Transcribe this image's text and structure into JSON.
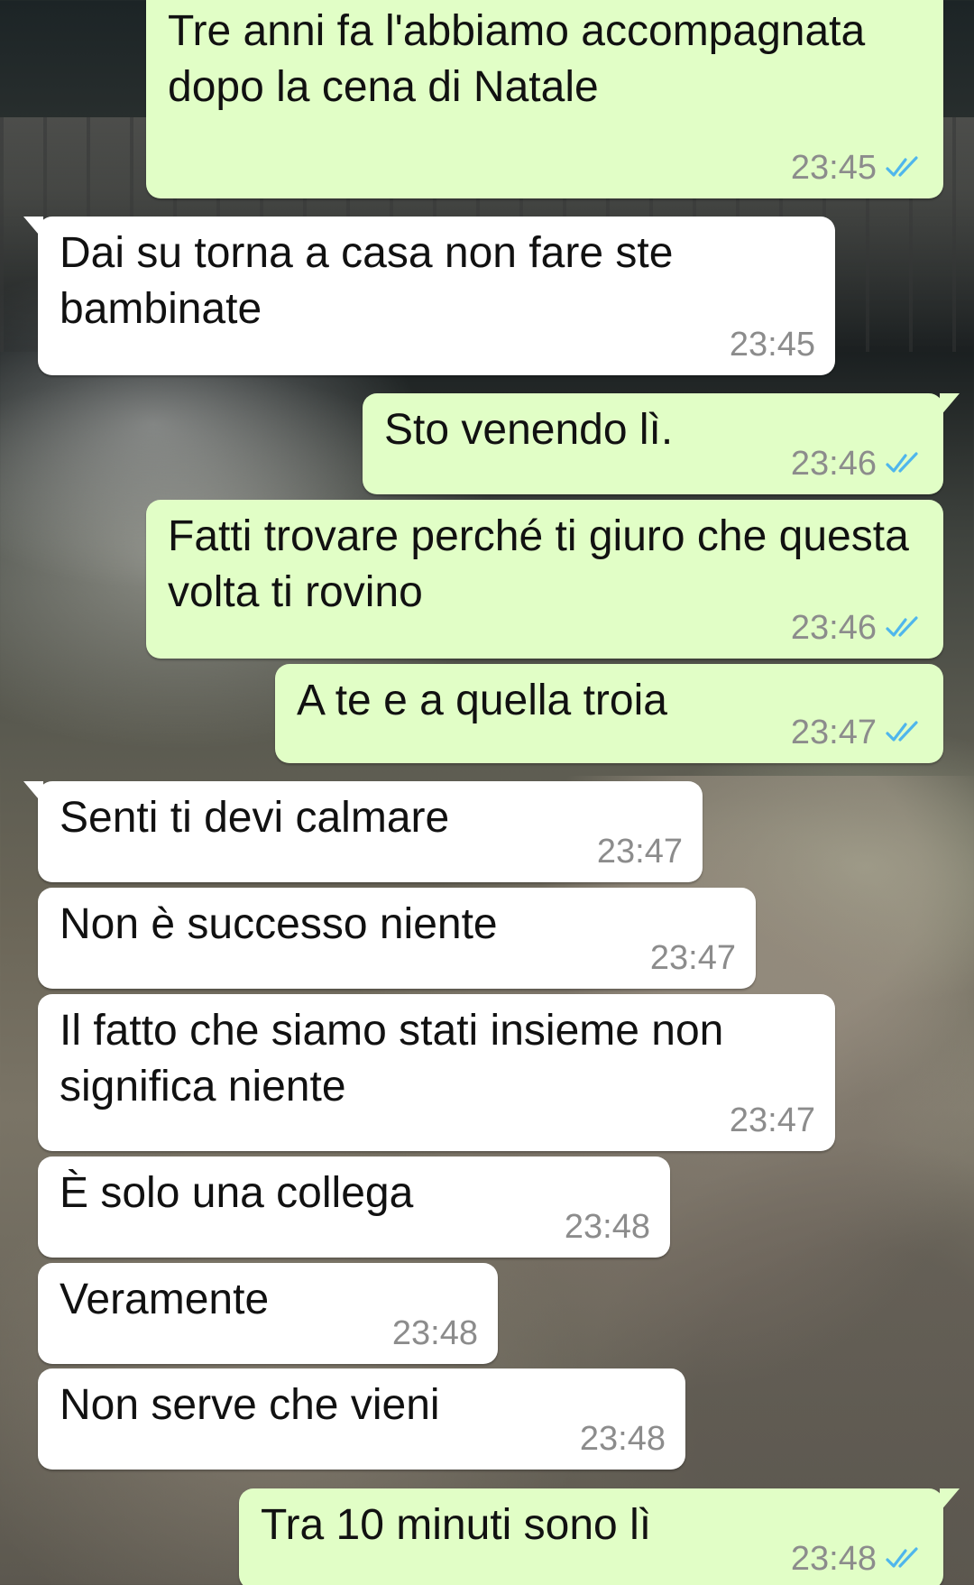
{
  "messages": [
    {
      "dir": "out",
      "text": "Tre anni fa l'abbiamo accompagnata dopo la cena di Natale",
      "time": "23:45",
      "status_icon": "double-check-icon"
    },
    {
      "dir": "in",
      "text": "Dai su torna a casa non fare ste bambinate",
      "time": "23:45"
    },
    {
      "dir": "out",
      "text": "Sto venendo lì.",
      "time": "23:46",
      "status_icon": "double-check-icon"
    },
    {
      "dir": "out",
      "text": "Fatti trovare perché ti giuro che questa volta ti rovino",
      "time": "23:46",
      "status_icon": "double-check-icon"
    },
    {
      "dir": "out",
      "text": "A te e a quella troia",
      "time": "23:47",
      "status_icon": "double-check-icon"
    },
    {
      "dir": "in",
      "text": "Senti ti devi calmare",
      "time": "23:47"
    },
    {
      "dir": "in",
      "text": "Non è successo niente",
      "time": "23:47"
    },
    {
      "dir": "in",
      "text": "Il fatto che siamo stati insieme non significa niente",
      "time": "23:47"
    },
    {
      "dir": "in",
      "text": "È solo una collega",
      "time": "23:48"
    },
    {
      "dir": "in",
      "text": "Veramente",
      "time": "23:48"
    },
    {
      "dir": "in",
      "text": "Non serve che vieni",
      "time": "23:48"
    },
    {
      "dir": "out",
      "text": "Tra 10 minuti sono lì",
      "time": "23:48",
      "status_icon": "double-check-icon"
    }
  ],
  "colors": {
    "outgoing_bubble": "#e1fec6",
    "incoming_bubble": "#ffffff",
    "timestamp": "#8c8c8c",
    "read_tick": "#4fb6ec"
  }
}
